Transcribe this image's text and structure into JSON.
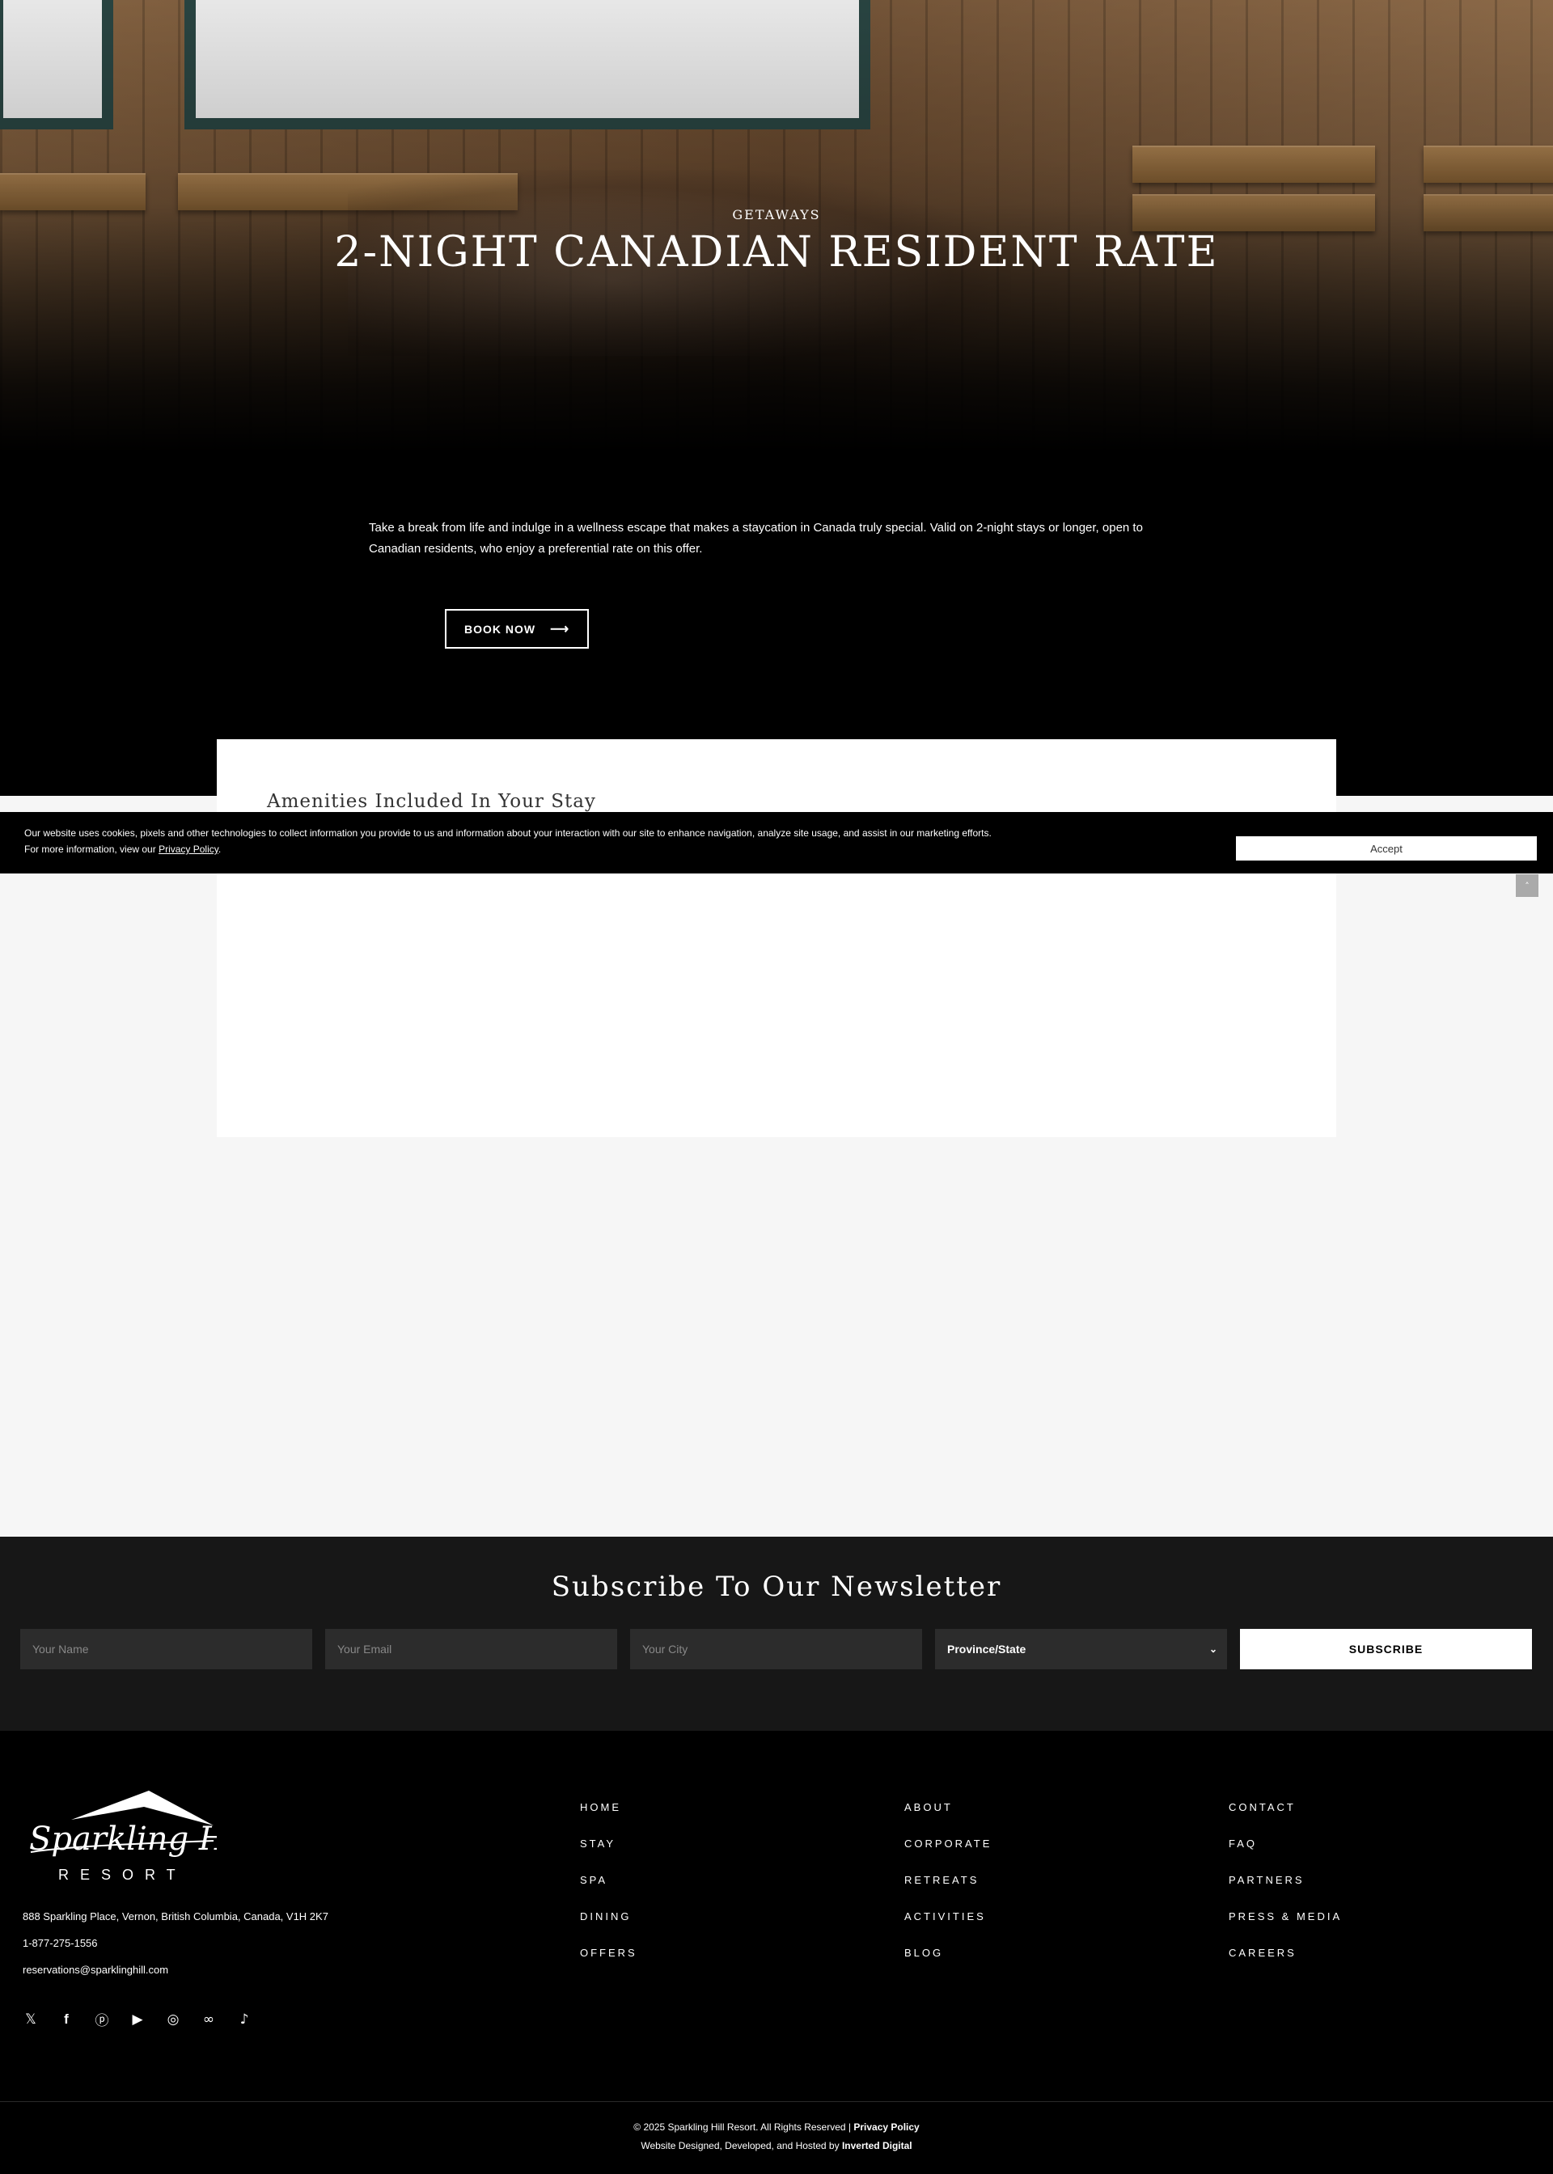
{
  "hero": {
    "eyebrow": "GETAWAYS",
    "title": "2-NIGHT CANADIAN RESIDENT RATE"
  },
  "intro": {
    "description": "Take a break from life and indulge in a wellness escape that makes a staycation in Canada truly special. Valid on 2-night stays or longer, open to Canadian residents, who enjoy a preferential rate on this offer.",
    "book_label": "BOOK NOW"
  },
  "amenities": {
    "heading": "Amenities Included In Your Stay"
  },
  "cookie": {
    "line1": "Our website uses cookies, pixels and other technologies to collect information you provide to us and information about your interaction with our site to enhance navigation, analyze site usage, and assist in our marketing efforts.",
    "line2_prefix": "For more information, view our ",
    "policy_link": "Privacy Policy",
    "line2_suffix": ".",
    "accept_label": "Accept"
  },
  "scroll_top": {
    "icon": "chevron-up-icon"
  },
  "newsletter": {
    "heading": "Subscribe To Our Newsletter",
    "name_placeholder": "Your Name",
    "email_placeholder": "Your Email",
    "city_placeholder": "Your City",
    "province_selected": "Province/State",
    "subscribe_label": "SUBSCRIBE"
  },
  "footer": {
    "logo_text": "Sparkling Hill",
    "logo_subtext": "RESORT",
    "address": "888 Sparkling Place, Vernon, British Columbia, Canada, V1H 2K7",
    "phone": "1-877-275-1556",
    "email": "reservations@sparklinghill.com",
    "social_icons": [
      "x-icon",
      "facebook-icon",
      "pinterest-icon",
      "youtube-icon",
      "instagram-icon",
      "tripadvisor-icon",
      "tiktok-icon"
    ],
    "nav_col1": [
      "HOME",
      "STAY",
      "SPA",
      "DINING",
      "OFFERS"
    ],
    "nav_col2": [
      "ABOUT",
      "CORPORATE",
      "RETREATS",
      "ACTIVITIES",
      "BLOG"
    ],
    "nav_col3": [
      "CONTACT",
      "FAQ",
      "PARTNERS",
      "PRESS & MEDIA",
      "CAREERS"
    ],
    "copyright": "© 2025 Sparkling Hill Resort. All Rights Reserved | ",
    "privacy_link": "Privacy Policy",
    "credit": "Website Designed, Developed, and Hosted by ",
    "credit_link": "Inverted Digital"
  }
}
